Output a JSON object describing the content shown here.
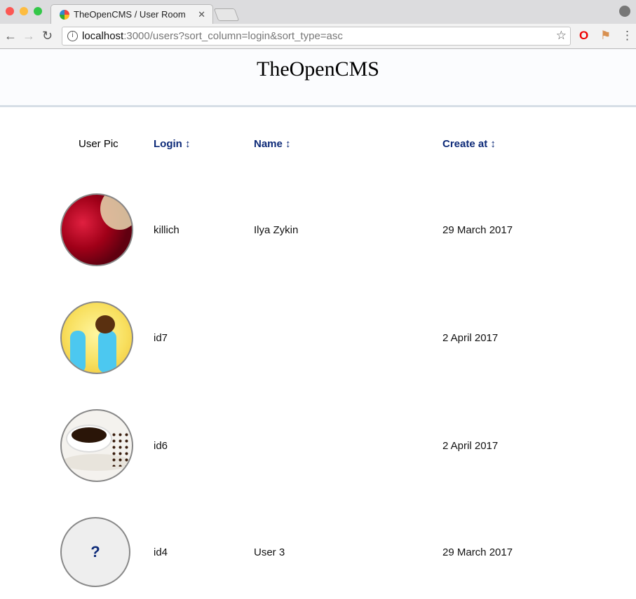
{
  "browser": {
    "tab_title": "TheOpenCMS / User Room",
    "url_host": "localhost",
    "url_rest": ":3000/users?sort_column=login&sort_type=asc"
  },
  "header": {
    "title": "TheOpenCMS"
  },
  "table": {
    "columns": [
      "User Pic",
      "Login ↕",
      "Name ↕",
      "Create at ↕"
    ],
    "rows": [
      {
        "avatar": "pomegranate-photo",
        "login": "killich",
        "name": "Ilya Zykin",
        "created": "29 March 2017"
      },
      {
        "avatar": "crying-emoji",
        "login": "id7",
        "name": "",
        "created": "2 April 2017"
      },
      {
        "avatar": "coffee-cup-photo",
        "login": "id6",
        "name": "",
        "created": "2 April 2017"
      },
      {
        "avatar": "placeholder",
        "placeholder_text": "?",
        "login": "id4",
        "name": "User 3",
        "created": "29 March 2017"
      }
    ]
  },
  "colors": {
    "link": "#0d2a78",
    "header_bg": "#fbfcfe"
  }
}
